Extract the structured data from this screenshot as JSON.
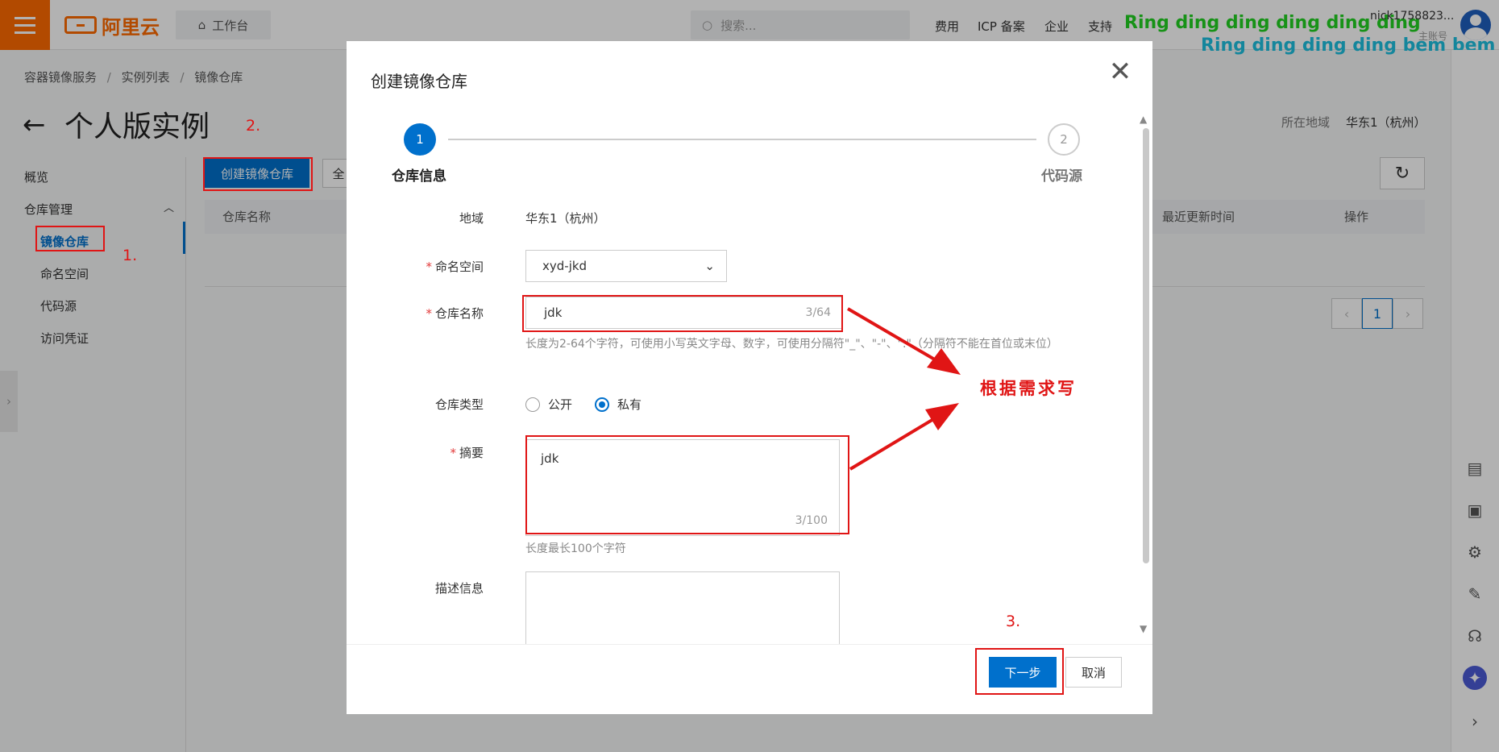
{
  "topbar": {
    "logo_text": "阿里云",
    "workbench": "工作台",
    "search_placeholder": "搜索...",
    "nav": [
      "费用",
      "ICP 备案",
      "企业",
      "支持"
    ],
    "lyric_line1": "Ring ding ding ding ding ding",
    "lyric_line2": "Ring ding ding ding bem bem bem",
    "username": "nick1758823...",
    "account_type": "主账号"
  },
  "breadcrumb": [
    "容器镜像服务",
    "实例列表",
    "镜像仓库"
  ],
  "breadcrumb_sep": "/",
  "page": {
    "back_arrow": "←",
    "title": "个人版实例",
    "region_label": "所在地域",
    "region_value": "华东1（杭州）"
  },
  "sidebar": {
    "overview": "概览",
    "repo_mgmt": "仓库管理",
    "items": [
      "镜像仓库",
      "命名空间",
      "代码源",
      "访问凭证"
    ]
  },
  "toolbar": {
    "create_button": "创建镜像仓库",
    "all_button": "全",
    "refresh_icon": "↻"
  },
  "table": {
    "columns": [
      "仓库名称",
      "最近更新时间",
      "操作"
    ]
  },
  "pagination": {
    "prev": "‹",
    "current": "1",
    "next": "›"
  },
  "modal": {
    "title": "创建镜像仓库",
    "close_icon": "✕",
    "steps": [
      {
        "number": "1",
        "label": "仓库信息",
        "active": true
      },
      {
        "number": "2",
        "label": "代码源",
        "active": false
      }
    ],
    "fields": {
      "region": {
        "label": "地域",
        "value": "华东1（杭州）"
      },
      "namespace": {
        "label": "命名空间",
        "required_mark": "*",
        "value": "xyd-jkd"
      },
      "repo_name": {
        "label": "仓库名称",
        "required_mark": "*",
        "value": "jdk",
        "counter": "3/64",
        "hint": "长度为2-64个字符，可使用小写英文字母、数字，可使用分隔符\"_\"、\"-\"、\".\"（分隔符不能在首位或末位）"
      },
      "repo_type": {
        "label": "仓库类型",
        "options": [
          "公开",
          "私有"
        ],
        "selected": "私有"
      },
      "summary": {
        "label": "摘要",
        "required_mark": "*",
        "value": "jdk",
        "counter": "3/100",
        "hint": "长度最长100个字符"
      },
      "description": {
        "label": "描述信息",
        "value": ""
      }
    },
    "next_button": "下一步",
    "cancel_button": "取消"
  },
  "annotations": {
    "step1": "1.",
    "step2": "2.",
    "step3": "3.",
    "note": "根据需求写",
    "color": "#e01515"
  },
  "colors": {
    "brand": "#ff6a00",
    "primary": "#0070cc"
  }
}
